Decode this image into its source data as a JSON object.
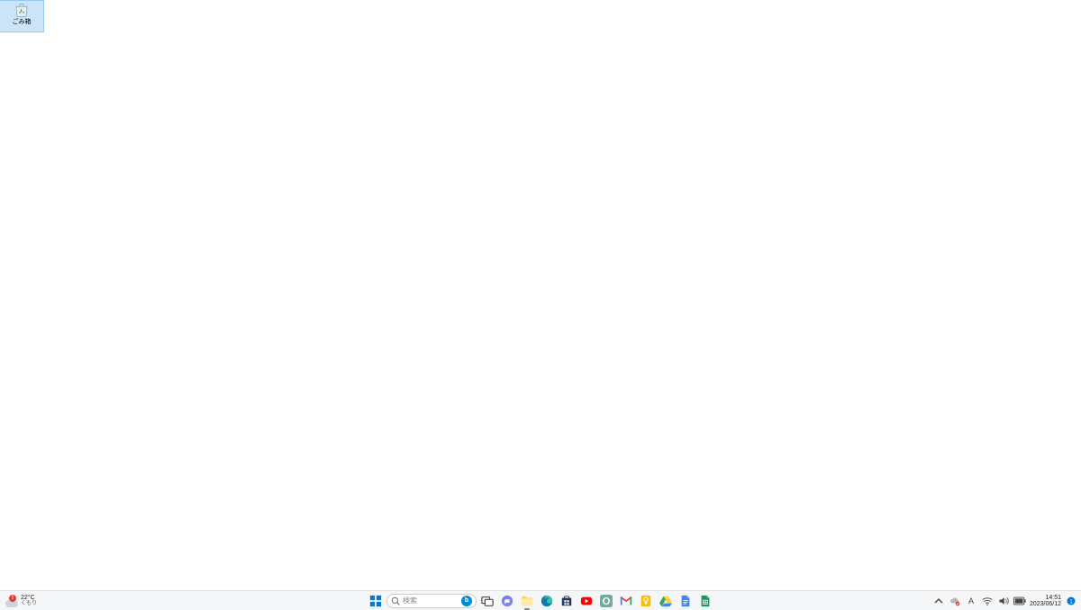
{
  "desktop": {
    "icons": [
      {
        "id": "recycle-bin",
        "label": "ごみ箱",
        "selected": true
      }
    ]
  },
  "taskbar": {
    "weather": {
      "temp": "22°C",
      "cond": "くもり",
      "alert": true
    },
    "search": {
      "placeholder": "検索",
      "bing_label": "b"
    },
    "apps": [
      {
        "id": "start",
        "name": "start-button"
      },
      {
        "id": "search",
        "name": "search-box"
      },
      {
        "id": "taskview",
        "name": "task-view"
      },
      {
        "id": "chat",
        "name": "chat-app"
      },
      {
        "id": "explorer",
        "name": "file-explorer",
        "running": true
      },
      {
        "id": "edge",
        "name": "edge-browser"
      },
      {
        "id": "store",
        "name": "microsoft-store"
      },
      {
        "id": "youtube",
        "name": "youtube-app"
      },
      {
        "id": "chatgpt",
        "name": "chatgpt-app"
      },
      {
        "id": "gmail",
        "name": "gmail-app"
      },
      {
        "id": "keep",
        "name": "google-keep"
      },
      {
        "id": "drive",
        "name": "google-drive"
      },
      {
        "id": "docs",
        "name": "google-docs"
      },
      {
        "id": "sheets",
        "name": "google-sheets"
      }
    ],
    "tray": {
      "chevron": "chevron-up-icon",
      "onedrive": "onedrive-icon",
      "ime": "A",
      "wifi": "wifi-icon",
      "volume": "volume-icon",
      "battery": "battery-icon"
    },
    "clock": {
      "time": "14:51",
      "date": "2023/06/12"
    },
    "notification_count": "1"
  }
}
